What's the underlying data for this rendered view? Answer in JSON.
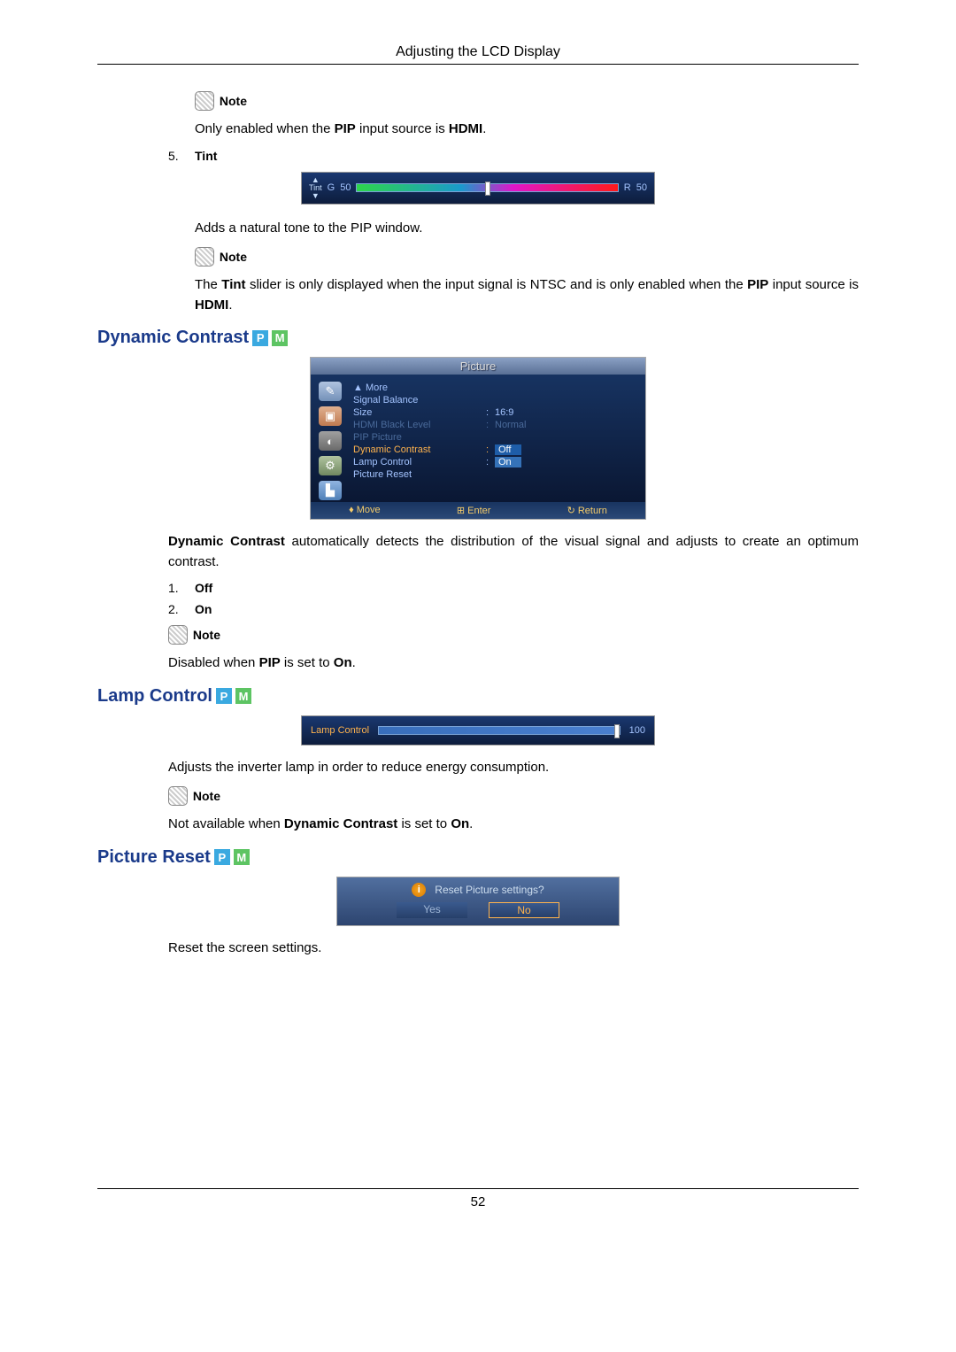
{
  "header": "Adjusting the LCD Display",
  "page_number": "52",
  "notes": {
    "label": "Note",
    "pip_hdmi": "Only enabled when the PIP input source is HDMI.",
    "tint_text": "The Tint slider is only displayed when the input signal is NTSC and is only enabled when the PIP input source is HDMI.",
    "pip_on": "Disabled when PIP is set to On.",
    "dc_on": "Not available when Dynamic Contrast is set to On."
  },
  "list5": {
    "num": "5.",
    "label": "Tint"
  },
  "tint": {
    "desc": "Adds a natural tone to the PIP window.",
    "label": "Tint",
    "g": "G",
    "g_val": "50",
    "r": "R",
    "r_val": "50"
  },
  "sections": {
    "dc_title": "Dynamic Contrast",
    "dc_desc_a": "Dynamic Contrast",
    "dc_desc_b": " automatically detects the distribution of the visual signal and adjusts to create an optimum contrast.",
    "dc_opt1": {
      "num": "1.",
      "label": "Off"
    },
    "dc_opt2": {
      "num": "2.",
      "label": "On"
    },
    "lamp_title": "Lamp Control",
    "lamp_desc": "Adjusts the inverter lamp in order to reduce energy consumption.",
    "reset_title": "Picture Reset",
    "reset_desc": "Reset the screen settings."
  },
  "osd": {
    "title": "Picture",
    "more": "▲ More",
    "rows": {
      "signal_balance": "Signal Balance",
      "size": "Size",
      "size_val": "16:9",
      "hdmi_black": "HDMI Black Level",
      "hdmi_black_val": "Normal",
      "pip_picture": "PIP Picture",
      "dynamic_contrast": "Dynamic Contrast",
      "dc_val": "Off",
      "lamp_control": "Lamp Control",
      "lamp_val": "On",
      "picture_reset": "Picture Reset"
    },
    "footer": {
      "move": "Move",
      "enter": "Enter",
      "return": "Return"
    }
  },
  "lamp_bar": {
    "label": "Lamp Control",
    "value": "100"
  },
  "reset_dialog": {
    "question": "Reset Picture settings?",
    "yes": "Yes",
    "no": "No"
  },
  "badges": {
    "p": "P",
    "m": "M"
  }
}
